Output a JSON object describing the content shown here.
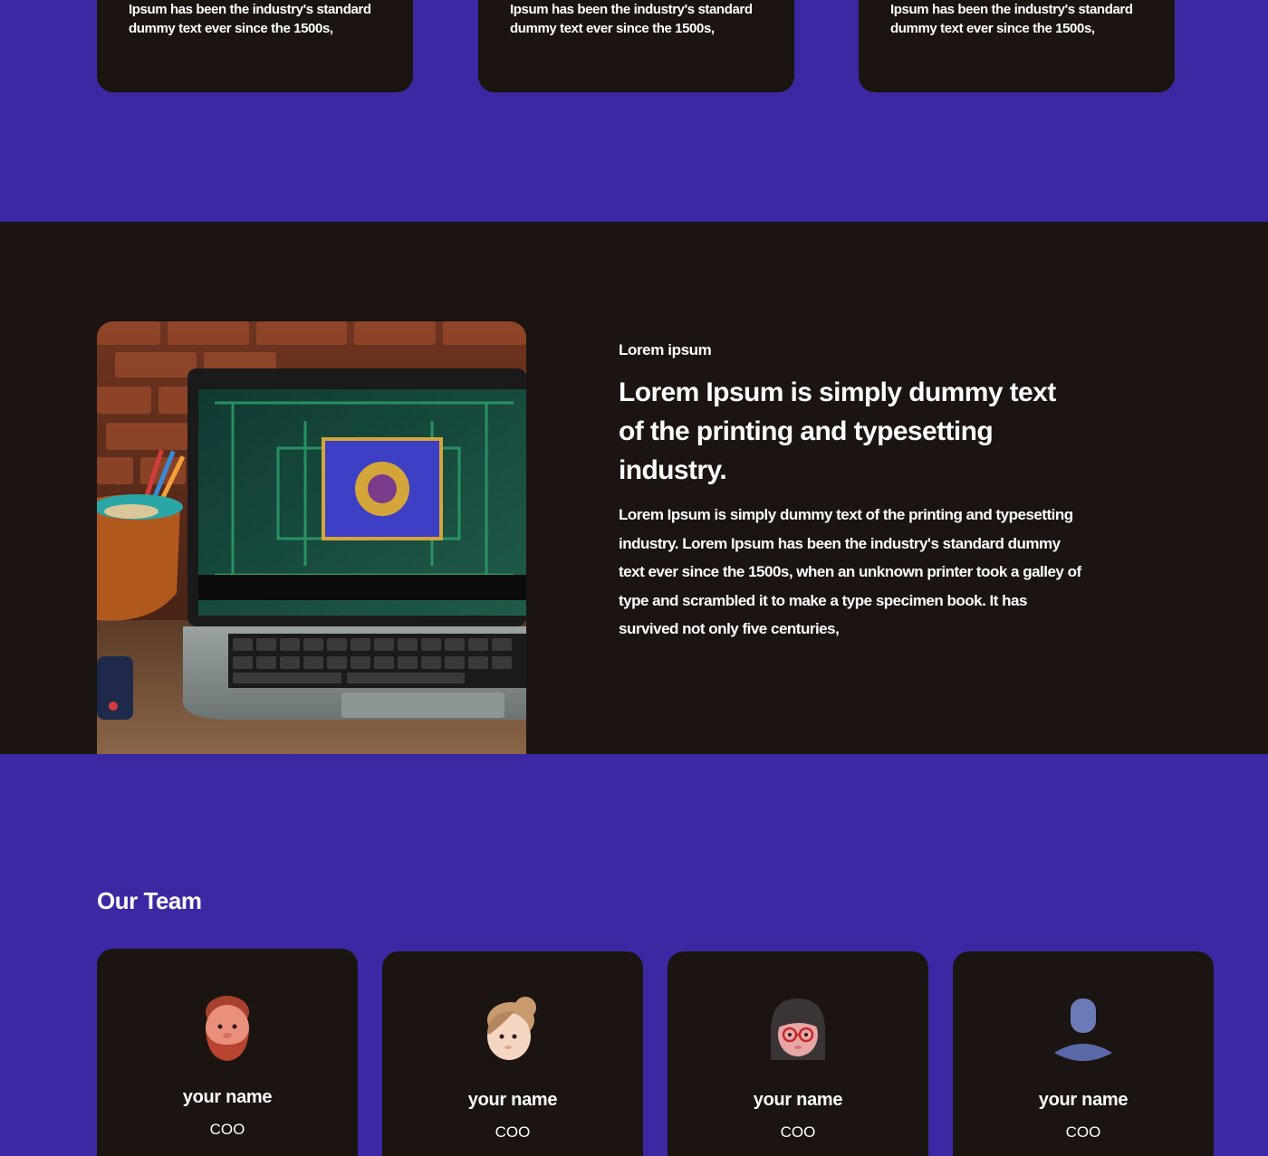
{
  "features": {
    "cards": [
      {
        "text": "Ipsum has been the industry's standard dummy text ever since the 1500s,"
      },
      {
        "text": "Ipsum has been the industry's standard dummy text ever since the 1500s,"
      },
      {
        "text": "Ipsum has been the industry's standard dummy text ever since the 1500s,"
      }
    ]
  },
  "about": {
    "image_icon": "laptop-photo",
    "eyebrow": "Lorem ipsum",
    "headline": "Lorem Ipsum is simply dummy text of the printing and typesetting industry.",
    "body": "Lorem Ipsum is simply dummy text of the printing and typesetting industry. Lorem Ipsum has been the industry's standard dummy text ever since the 1500s, when an unknown printer took a galley of type and scrambled it to make a type specimen book. It has survived not only five centuries,"
  },
  "team": {
    "title": "Our Team",
    "members": [
      {
        "name": "your name",
        "role": "COO",
        "avatar_icon": "bearded-man-avatar-icon"
      },
      {
        "name": "your name",
        "role": "COO",
        "avatar_icon": "woman-bun-avatar-icon"
      },
      {
        "name": "your name",
        "role": "COO",
        "avatar_icon": "woman-glasses-avatar-icon"
      },
      {
        "name": "your name",
        "role": "COO",
        "avatar_icon": "generic-user-avatar-icon"
      }
    ]
  },
  "colors": {
    "purple": "#3c28a3",
    "dark": "#1b1410",
    "text": "#ffffff"
  }
}
